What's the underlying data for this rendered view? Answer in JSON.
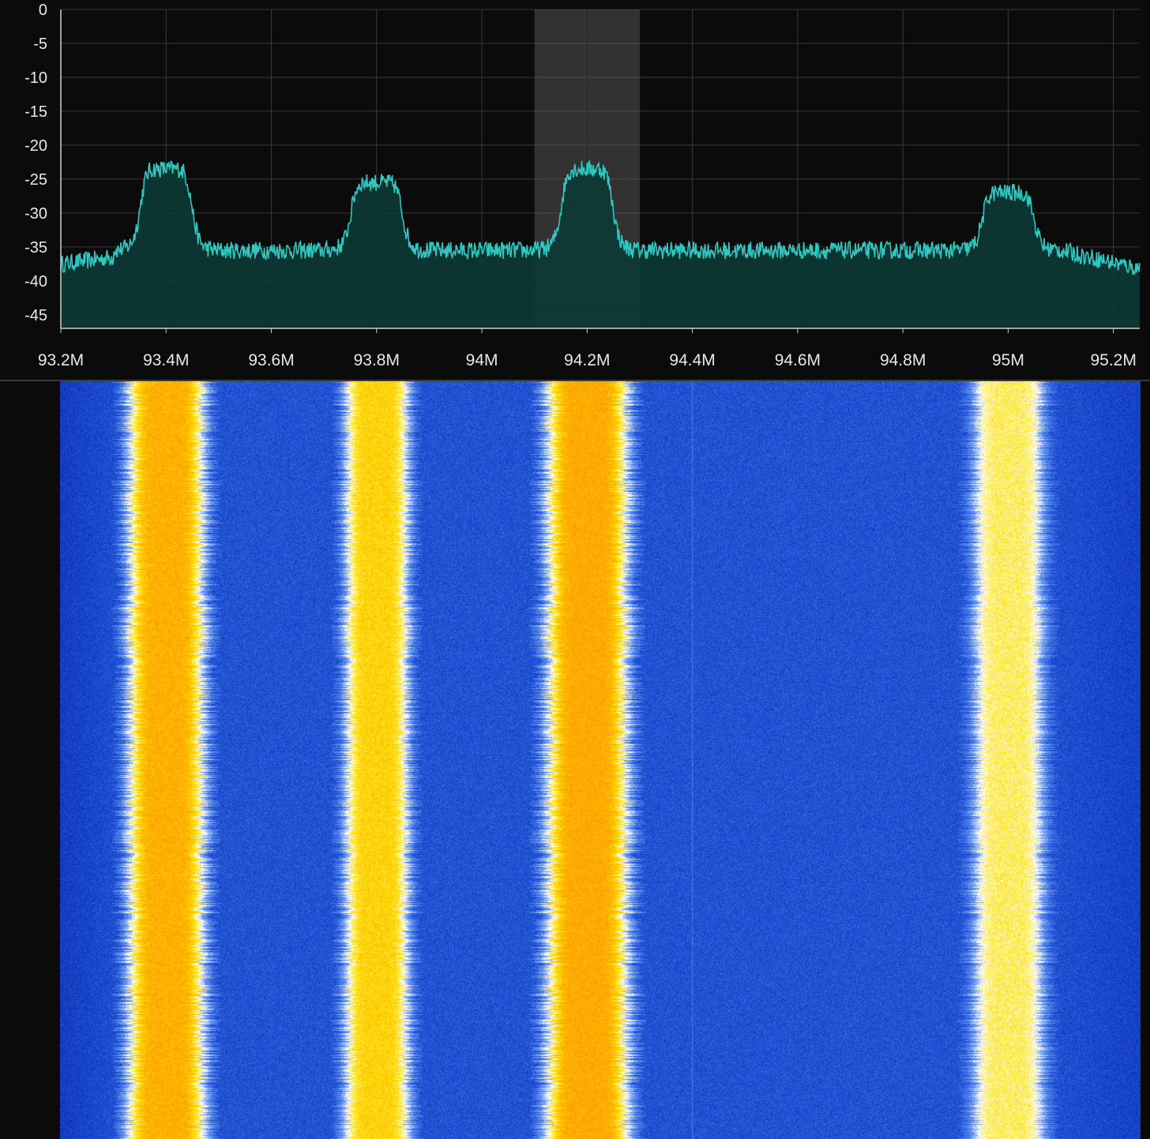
{
  "spectrum": {
    "y_tick_labels": [
      "0",
      "-5",
      "-10",
      "-15",
      "-20",
      "-25",
      "-30",
      "-35",
      "-40",
      "-45"
    ],
    "x_tick_labels": [
      "93.2M",
      "93.4M",
      "93.6M",
      "93.8M",
      "94M",
      "94.2M",
      "94.4M",
      "94.6M",
      "94.8M",
      "95M",
      "95.2M"
    ],
    "selected_band_mhz": [
      94.1,
      94.3
    ],
    "colors": {
      "background": "#0b0b0b",
      "grid": "#3a3a3a",
      "trace": "#2ec8c0",
      "fill": "#0d3a36",
      "selection": "#6a6a6a"
    }
  },
  "chart_data": {
    "type": "area",
    "xlabel": "",
    "ylabel": "",
    "xlim": [
      93.2,
      95.25
    ],
    "ylim": [
      -47,
      0
    ],
    "grid": true,
    "noise_floor_db": -35.5,
    "peaks": [
      {
        "center_mhz": 93.4,
        "level_db": -25
      },
      {
        "center_mhz": 93.8,
        "level_db": -27
      },
      {
        "center_mhz": 94.2,
        "level_db": -25
      },
      {
        "center_mhz": 95.0,
        "level_db": -28.5
      }
    ]
  },
  "waterfall": {
    "colormap": [
      "#00108a",
      "#1a4bd0",
      "#5a8cf0",
      "#ffffff",
      "#ffe000",
      "#ff9c00"
    ]
  }
}
